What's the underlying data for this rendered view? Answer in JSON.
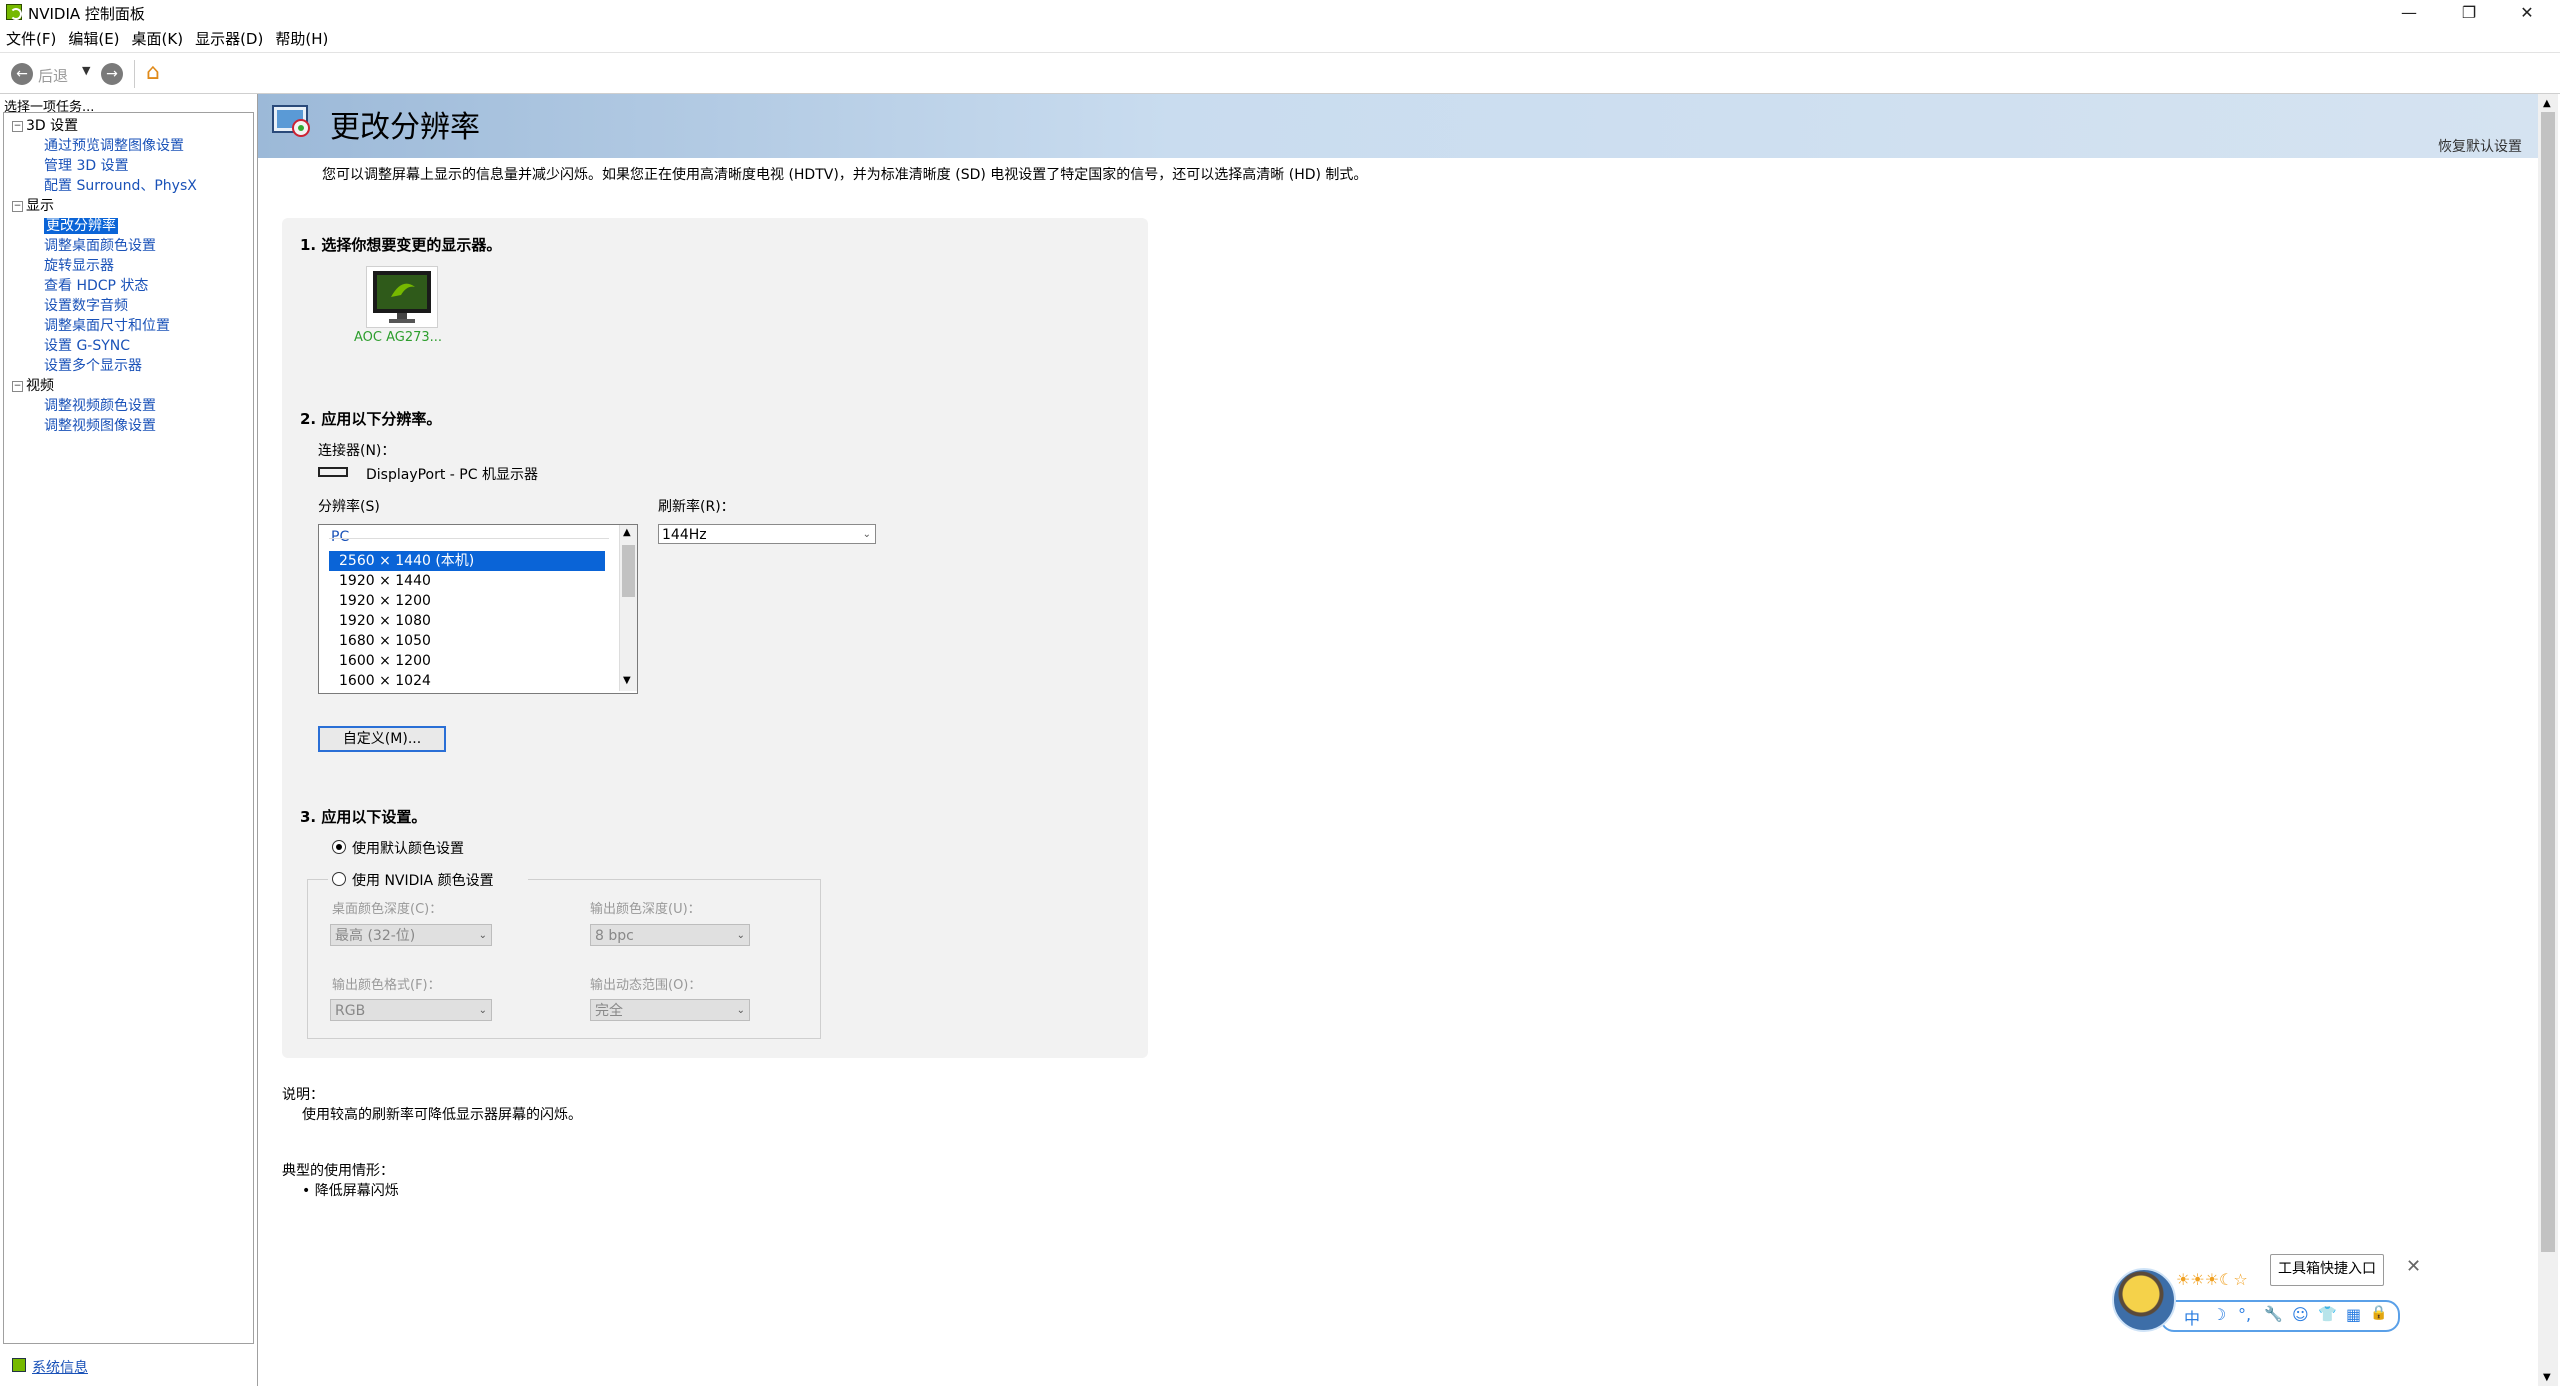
{
  "window": {
    "title": "NVIDIA 控制面板",
    "controls": {
      "minimize": "—",
      "maximize": "❐",
      "close": "✕"
    }
  },
  "menu": [
    "文件(F)",
    "编辑(E)",
    "桌面(K)",
    "显示器(D)",
    "帮助(H)"
  ],
  "toolbar": {
    "back_label": "后退"
  },
  "sidebar": {
    "header": "选择一项任务...",
    "tree": [
      {
        "type": "category",
        "label": "3D 设置"
      },
      {
        "type": "link",
        "label": "通过预览调整图像设置"
      },
      {
        "type": "link",
        "label": "管理 3D 设置"
      },
      {
        "type": "link",
        "label": "配置 Surround、PhysX"
      },
      {
        "type": "category",
        "label": "显示"
      },
      {
        "type": "selected",
        "label": "更改分辨率"
      },
      {
        "type": "link",
        "label": "调整桌面颜色设置"
      },
      {
        "type": "link",
        "label": "旋转显示器"
      },
      {
        "type": "link",
        "label": "查看 HDCP 状态"
      },
      {
        "type": "link",
        "label": "设置数字音频"
      },
      {
        "type": "link",
        "label": "调整桌面尺寸和位置"
      },
      {
        "type": "link",
        "label": "设置 G-SYNC"
      },
      {
        "type": "link",
        "label": "设置多个显示器"
      },
      {
        "type": "category",
        "label": "视频"
      },
      {
        "type": "link",
        "label": "调整视频颜色设置"
      },
      {
        "type": "link",
        "label": "调整视频图像设置"
      }
    ],
    "system_info": "系统信息"
  },
  "page": {
    "title": "更改分辨率",
    "restore_defaults": "恢复默认设置",
    "intro": "您可以调整屏幕上显示的信息量并减少闪烁。如果您正在使用高清晰度电视 (HDTV)，并为标准清晰度 (SD) 电视设置了特定国家的信号，还可以选择高清晰 (HD) 制式。",
    "step1": {
      "title": "1. 选择你想要变更的显示器。",
      "monitor_label": "AOC AG273..."
    },
    "step2": {
      "title": "2. 应用以下分辨率。",
      "connector_label": "连接器(N)：",
      "connector_value": "DisplayPort - PC 机显示器",
      "resolution_label": "分辨率(S)",
      "resolution_group": "PC",
      "resolutions": [
        "2560 × 1440 (本机)",
        "1920 × 1440",
        "1920 × 1200",
        "1920 × 1080",
        "1680 × 1050",
        "1600 × 1200",
        "1600 × 1024"
      ],
      "refresh_label": "刷新率(R)：",
      "refresh_value": "144Hz",
      "custom_button": "自定义(M)..."
    },
    "step3": {
      "title": "3. 应用以下设置。",
      "radio_default": "使用默认颜色设置",
      "radio_nvidia": "使用 NVIDIA 颜色设置",
      "desktop_depth_label": "桌面颜色深度(C)：",
      "desktop_depth_value": "最高 (32-位)",
      "output_depth_label": "输出颜色深度(U)：",
      "output_depth_value": "8 bpc",
      "output_format_label": "输出颜色格式(F)：",
      "output_format_value": "RGB",
      "output_range_label": "输出动态范围(O)：",
      "output_range_value": "完全"
    },
    "description": {
      "heading": "说明：",
      "text": "使用较高的刷新率可降低显示器屏幕的闪烁。"
    },
    "typical": {
      "heading": "典型的使用情形：",
      "item": "• 降低屏幕闪烁"
    }
  },
  "widget": {
    "tooltip": "工具箱快捷入口",
    "bar_items": [
      "中",
      "☽",
      "°,",
      "🔧",
      "☺",
      "👕",
      "▦",
      "🔒"
    ],
    "stars": "☀☀☀☾☆"
  },
  "colors": {
    "accent": "#0a64d7",
    "nvidia_green": "#76b900",
    "banner": "#b9cfe6",
    "link": "#1a52b8"
  }
}
